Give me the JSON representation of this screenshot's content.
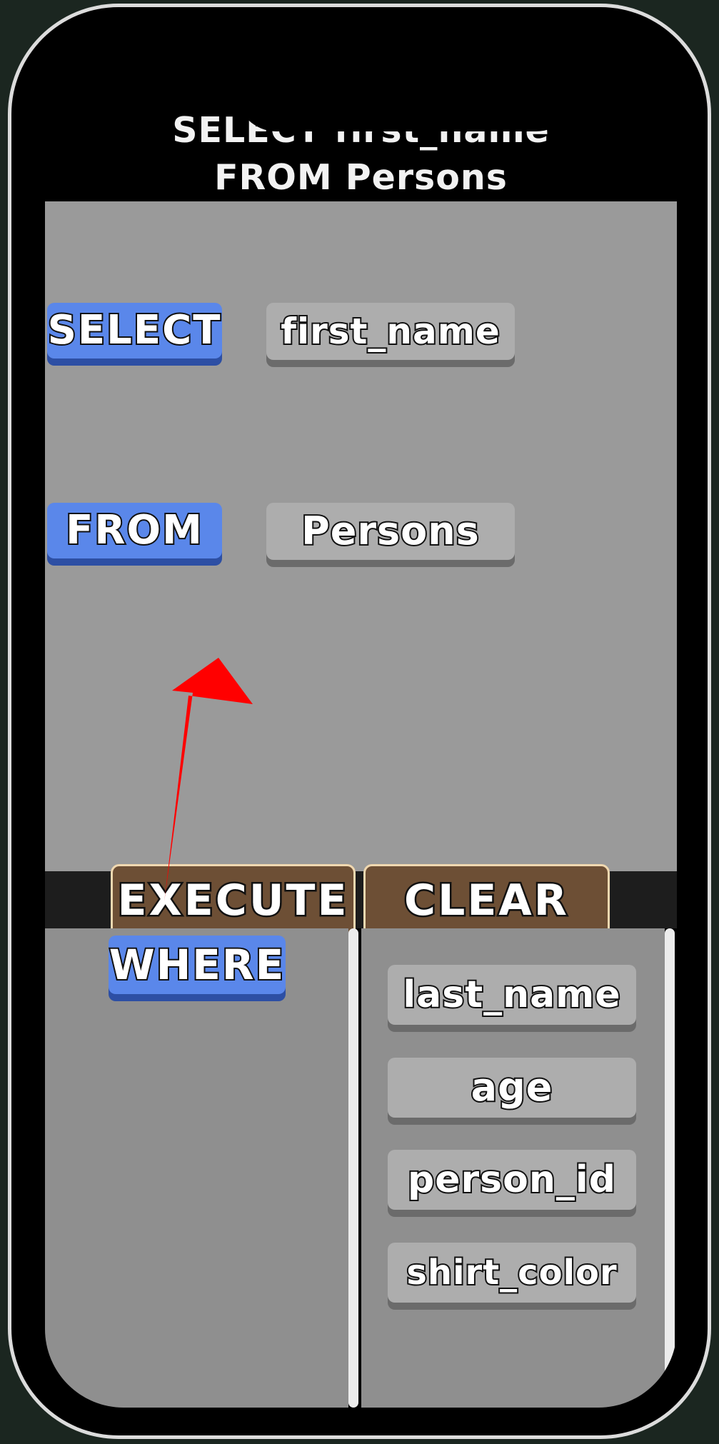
{
  "query": {
    "line1": "SELECT first_name",
    "line2": "FROM Persons"
  },
  "workspace": {
    "select_keyword": "SELECT",
    "select_field": "first_name",
    "from_keyword": "FROM",
    "from_table": "Persons"
  },
  "buttons": {
    "execute": "EXECUTE",
    "clear": "CLEAR"
  },
  "keyword_palette": {
    "items": [
      "WHERE"
    ]
  },
  "field_palette": {
    "items": [
      "last_name",
      "age",
      "person_id",
      "shirt_color"
    ]
  },
  "hint": {
    "icon": "red-arrow-icon",
    "color": "#ff0000"
  },
  "colors": {
    "keyword_block": "#5a87ea",
    "field_block": "#adadad",
    "action_button": "#6d4f35",
    "workspace_bg": "#9a9a9a"
  }
}
